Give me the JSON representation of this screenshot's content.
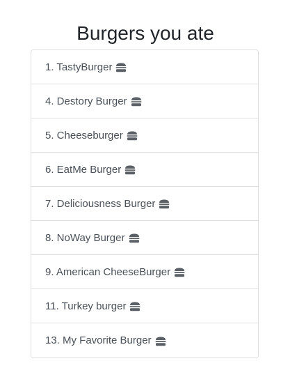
{
  "title": "Burgers you ate",
  "icon": "hamburger-icon",
  "colors": {
    "text": "#495057",
    "title": "#212529",
    "border": "#dfdfdf",
    "icon": "#5a6066"
  },
  "burgers": [
    {
      "label": "1. TastyBurger"
    },
    {
      "label": "4. Destory Burger"
    },
    {
      "label": "5. Cheeseburger"
    },
    {
      "label": "6. EatMe Burger"
    },
    {
      "label": "7. Deliciousness Burger"
    },
    {
      "label": "8. NoWay Burger"
    },
    {
      "label": "9. American CheeseBurger"
    },
    {
      "label": "11. Turkey burger"
    },
    {
      "label": "13. My Favorite Burger"
    }
  ]
}
